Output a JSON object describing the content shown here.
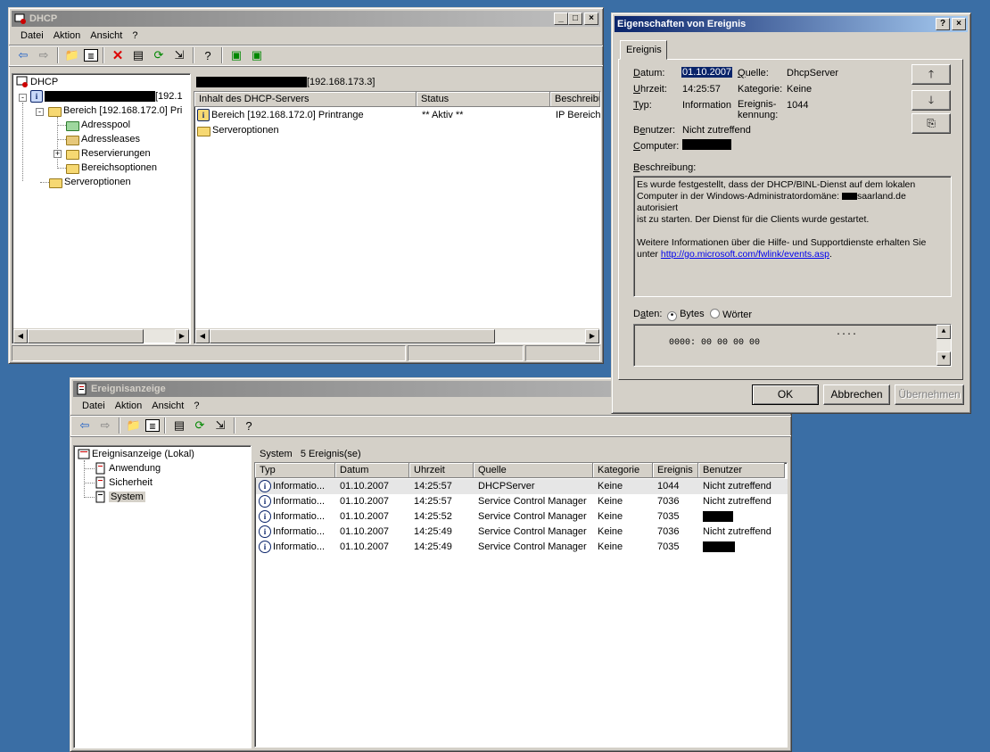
{
  "dhcp": {
    "title": "DHCP",
    "menu": [
      "Datei",
      "Aktion",
      "Ansicht",
      "?"
    ],
    "tree": {
      "root": "DHCP",
      "server_suffix": "[192.1",
      "scope": "Bereich [192.168.172.0] Pri",
      "children": [
        "Adresspool",
        "Adressleases",
        "Reservierungen",
        "Bereichsoptionen"
      ],
      "server_options": "Serveroptionen"
    },
    "right_header_suffix": "[192.168.173.3]",
    "columns": [
      "Inhalt des DHCP-Servers",
      "Status",
      "Beschreibu"
    ],
    "rows": [
      {
        "name": "Bereich [192.168.172.0] Printrange",
        "status": "** Aktiv **",
        "desc": "IP Bereich"
      },
      {
        "name": "Serveroptionen",
        "status": "",
        "desc": ""
      }
    ]
  },
  "props": {
    "title": "Eigenschaften von Ereignis",
    "tab": "Ereignis",
    "labels": {
      "datum": "Datum:",
      "uhrzeit": "Uhrzeit:",
      "typ": "Typ:",
      "benutzer": "Benutzer:",
      "computer": "Computer:",
      "quelle": "Quelle:",
      "kategorie": "Kategorie:",
      "kennung": "Ereignis-\nkennung:",
      "beschreibung": "Beschreibung:",
      "daten": "Daten:",
      "bytes": "Bytes",
      "woerter": "Wörter"
    },
    "values": {
      "datum": "01.10.2007",
      "uhrzeit": "14:25:57",
      "typ": "Information",
      "benutzer": "Nicht zutreffend",
      "quelle": "DhcpServer",
      "kategorie": "Keine",
      "kennung": "1044"
    },
    "description": {
      "line1": "Es wurde festgestellt, dass der DHCP/BINL-Dienst auf dem lokalen",
      "line2_pre": "Computer in der Windows-Administratordomäne:",
      "line2_post": "saarland.de autorisiert",
      "line3": "ist zu starten. Der Dienst für die Clients wurde gestartet.",
      "line4": "Weitere Informationen über die Hilfe- und Supportdienste erhalten Sie",
      "line5_pre": "unter",
      "link": "http://go.microsoft.com/fwlink/events.asp",
      "line5_post": "."
    },
    "data_hex": "0000: 00 00 00 00",
    "data_ascii": "....",
    "buttons": {
      "ok": "OK",
      "cancel": "Abbrechen",
      "apply": "Übernehmen"
    }
  },
  "events": {
    "title": "Ereignisanzeige",
    "menu": [
      "Datei",
      "Aktion",
      "Ansicht",
      "?"
    ],
    "tree": {
      "root": "Ereignisanzeige (Lokal)",
      "children": [
        "Anwendung",
        "Sicherheit",
        "System"
      ]
    },
    "list_title": "System",
    "list_count": "5 Ereignis(se)",
    "columns": [
      "Typ",
      "Datum",
      "Uhrzeit",
      "Quelle",
      "Kategorie",
      "Ereignis",
      "Benutzer"
    ],
    "rows": [
      {
        "typ": "Informatio...",
        "datum": "01.10.2007",
        "uhrzeit": "14:25:57",
        "quelle": "DHCPServer",
        "kategorie": "Keine",
        "ereignis": "1044",
        "benutzer": "Nicht zutreffend"
      },
      {
        "typ": "Informatio...",
        "datum": "01.10.2007",
        "uhrzeit": "14:25:57",
        "quelle": "Service Control Manager",
        "kategorie": "Keine",
        "ereignis": "7036",
        "benutzer": "Nicht zutreffend"
      },
      {
        "typ": "Informatio...",
        "datum": "01.10.2007",
        "uhrzeit": "14:25:52",
        "quelle": "Service Control Manager",
        "kategorie": "Keine",
        "ereignis": "7035",
        "benutzer": ""
      },
      {
        "typ": "Informatio...",
        "datum": "01.10.2007",
        "uhrzeit": "14:25:49",
        "quelle": "Service Control Manager",
        "kategorie": "Keine",
        "ereignis": "7036",
        "benutzer": "Nicht zutreffend"
      },
      {
        "typ": "Informatio...",
        "datum": "01.10.2007",
        "uhrzeit": "14:25:49",
        "quelle": "Service Control Manager",
        "kategorie": "Keine",
        "ereignis": "7035",
        "benutzer": ""
      }
    ]
  }
}
